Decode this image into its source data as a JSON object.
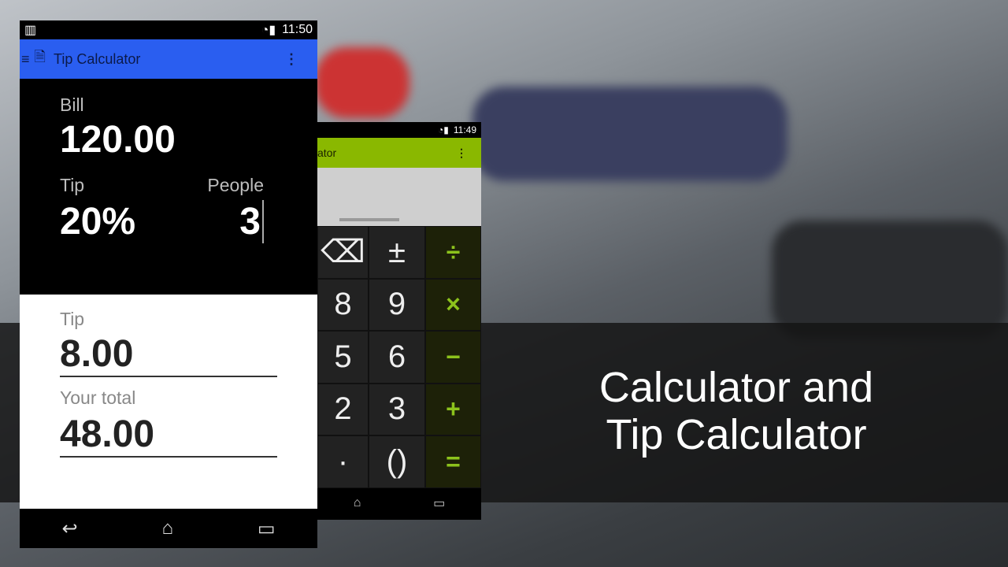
{
  "headline": {
    "line1": "Calculator and",
    "line2": "Tip Calculator"
  },
  "tip_app": {
    "status": {
      "time": "11:50"
    },
    "title": "Tip Calculator",
    "inputs": {
      "bill_label": "Bill",
      "bill_value": "120.00",
      "tip_label": "Tip",
      "tip_value": "20%",
      "people_label": "People",
      "people_value": "3"
    },
    "results": {
      "tip_label": "Tip",
      "tip_value": "8.00",
      "total_label": "Your total",
      "total_value": "48.00"
    }
  },
  "calc_app": {
    "status": {
      "time": "11:49"
    },
    "title": "ator",
    "keys": [
      [
        "⌫",
        "±",
        "÷"
      ],
      [
        "8",
        "9",
        "×"
      ],
      [
        "5",
        "6",
        "−"
      ],
      [
        "2",
        "3",
        "+"
      ],
      [
        "·",
        "()",
        "="
      ]
    ]
  }
}
